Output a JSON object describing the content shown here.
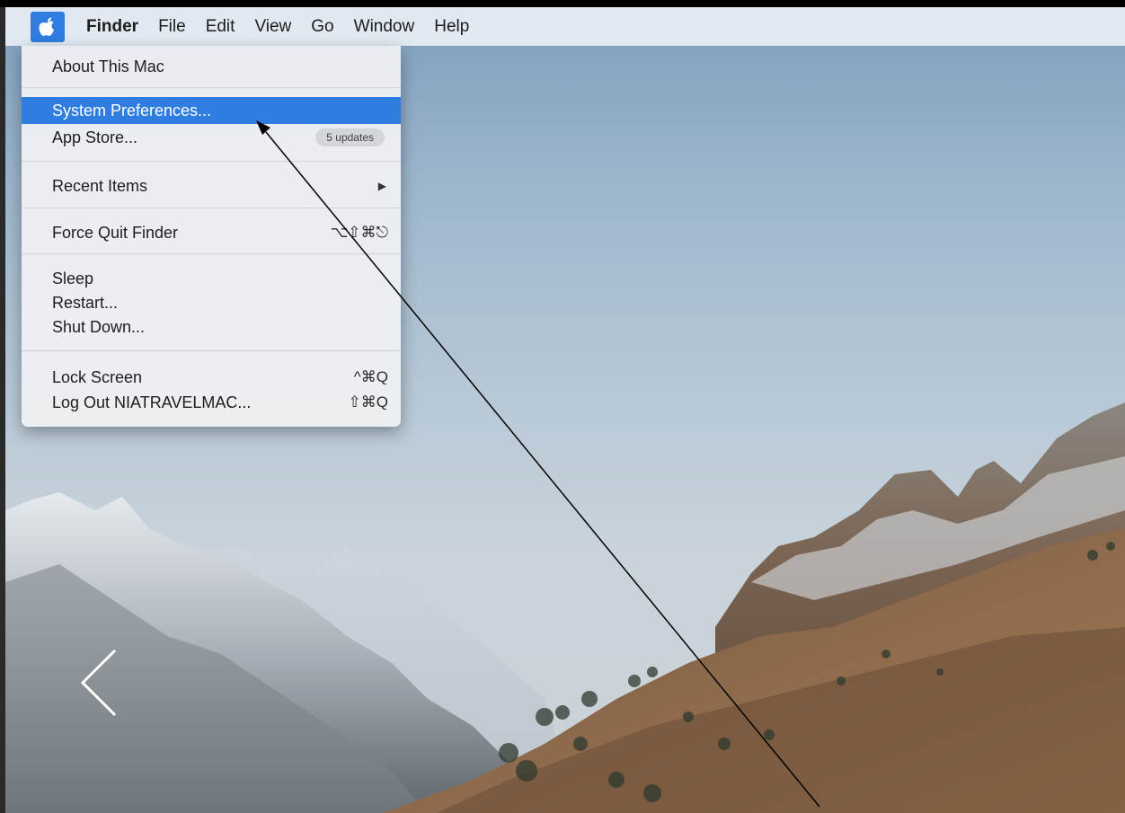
{
  "menubar": {
    "apple_icon": "apple-logo-icon",
    "items": [
      "Finder",
      "File",
      "Edit",
      "View",
      "Go",
      "Window",
      "Help"
    ]
  },
  "apple_menu": {
    "about": "About This Mac",
    "system_preferences": "System Preferences...",
    "app_store": "App Store...",
    "app_store_badge": "5 updates",
    "recent_items": "Recent Items",
    "force_quit": "Force Quit Finder",
    "force_quit_shortcut": "⌥⇧⌘⎋",
    "sleep": "Sleep",
    "restart": "Restart...",
    "shut_down": "Shut Down...",
    "lock_screen": "Lock Screen",
    "lock_screen_shortcut": "^⌘Q",
    "log_out": "Log Out NIATRAVELMAC...",
    "log_out_shortcut": "⇧⌘Q"
  },
  "colors": {
    "highlight": "#2f7de1",
    "menu_bg": "#eceff3"
  }
}
